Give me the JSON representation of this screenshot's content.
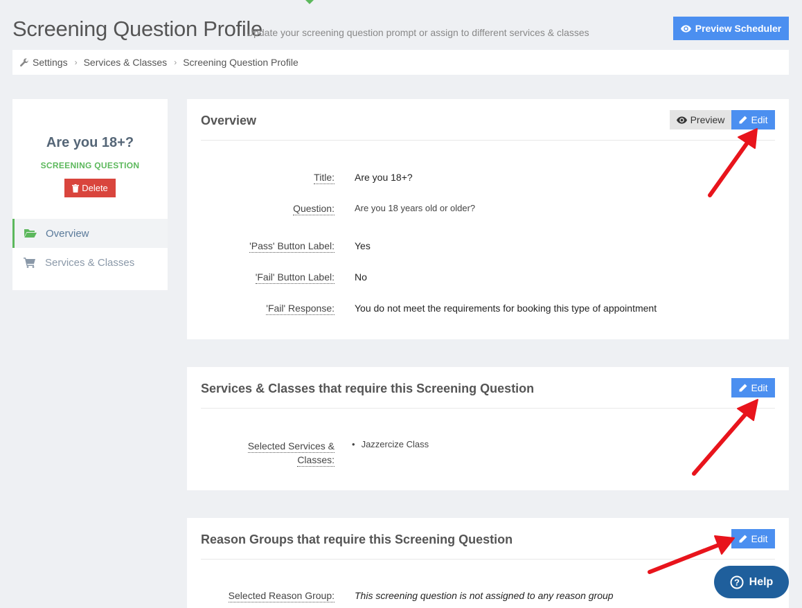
{
  "header": {
    "title": "Screening Question Profile",
    "subtitle": "Update your screening question prompt or assign to different services & classes",
    "preview_scheduler_label": "Preview Scheduler"
  },
  "breadcrumb": {
    "items": [
      "Settings",
      "Services & Classes",
      "Screening Question Profile"
    ]
  },
  "sidebar": {
    "title": "Are you 18+?",
    "subtitle": "SCREENING QUESTION",
    "delete_label": "Delete",
    "nav": [
      {
        "label": "Overview",
        "icon": "folder-open-icon",
        "active": true
      },
      {
        "label": "Services & Classes",
        "icon": "shopping-cart-icon",
        "active": false
      }
    ]
  },
  "overview": {
    "title": "Overview",
    "preview_label": "Preview",
    "edit_label": "Edit",
    "fields": [
      {
        "label": "Title:",
        "value": "Are you 18+?"
      },
      {
        "label": "Question:",
        "value": "Are you 18 years old or older?"
      },
      {
        "label": "'Pass' Button Label:",
        "value": "Yes"
      },
      {
        "label": "'Fail' Button Label:",
        "value": "No"
      },
      {
        "label": "'Fail' Response:",
        "value": "You do not meet the requirements for booking this type of appointment"
      }
    ]
  },
  "services": {
    "title": "Services & Classes that require this Screening Question",
    "edit_label": "Edit",
    "label_line1": "Selected Services &",
    "label_line2": "Classes:",
    "items": [
      "Jazzercize Class"
    ]
  },
  "reasons": {
    "title": "Reason Groups that require this Screening Question",
    "edit_label": "Edit",
    "label": "Selected Reason Group:",
    "value": "This screening question is not assigned to any reason group"
  },
  "help": {
    "label": "Help"
  },
  "colors": {
    "primary": "#4b8ff0",
    "success": "#5cb85c",
    "danger": "#d9453d",
    "annotation": "#e8141c",
    "help": "#1f5f9c"
  }
}
